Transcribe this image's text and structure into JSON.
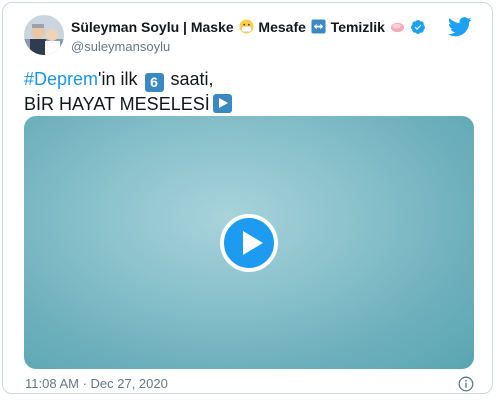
{
  "author": {
    "name_parts": [
      "Süleyman Soylu | Maske",
      " Mesafe",
      " Temizlik"
    ],
    "emoji_icons": [
      "face-with-mask-icon",
      "left-right-arrow-icon",
      "soap-icon"
    ],
    "handle": "@suleymansoylu",
    "verified": true
  },
  "tweet": {
    "hashtag": "#Deprem",
    "text_after_hashtag": "'in ilk",
    "keycap_number": "6",
    "text_after_keycap": " saati,",
    "line2": "BİR HAYAT MESELESİ",
    "line2_emoji": "play-button-emoji"
  },
  "media": {
    "type": "video",
    "play_icon": "play-icon"
  },
  "footer": {
    "timestamp": "11:08 AM · Dec 27, 2020",
    "info_icon": "info-icon"
  },
  "colors": {
    "brand": "#1d9bf0",
    "hashtag": "#1b95e0",
    "muted_text": "#657786",
    "video_bg": "#6db0bc"
  }
}
